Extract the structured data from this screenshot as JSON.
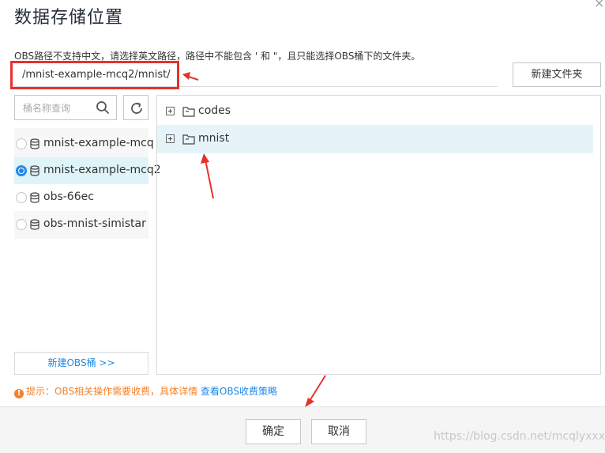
{
  "dialog": {
    "title": "数据存储位置",
    "close_glyph": "×"
  },
  "path": {
    "hint": "OBS路径不支持中文，请选择英文路径，路径中不能包含 ' 和 \"，且只能选择OBS桶下的文件夹。",
    "value": "/mnist-example-mcq2/mnist/",
    "new_folder_label": "新建文件夹"
  },
  "buckets": {
    "search_placeholder": "桶名称查询",
    "items": [
      {
        "name": "mnist-example-mcq",
        "selected": false
      },
      {
        "name": "mnist-example-mcq2",
        "selected": true
      },
      {
        "name": "obs-66ec",
        "selected": false
      },
      {
        "name": "obs-mnist-simistar",
        "selected": false
      }
    ],
    "new_bucket_label": "新建OBS桶 >>"
  },
  "folders": [
    {
      "name": "codes",
      "highlighted": false
    },
    {
      "name": "mnist",
      "highlighted": true
    }
  ],
  "tip": {
    "icon": "!",
    "text": "提示：OBS相关操作需要收费，具体详情",
    "link": "查看OBS收费策略"
  },
  "footer": {
    "ok_label": "确定",
    "cancel_label": "取消",
    "watermark": "https://blog.csdn.net/mcqlyxxx"
  },
  "colors": {
    "accent": "#1e88e5",
    "annotation_red": "#e5322d",
    "warning": "#f5822a",
    "selected_bg": "#dff4f8"
  },
  "icons": {
    "search": "search-icon",
    "refresh": "refresh-icon",
    "bucket": "database-icon",
    "folder": "folder-icon",
    "expand": "plus-square-icon"
  }
}
